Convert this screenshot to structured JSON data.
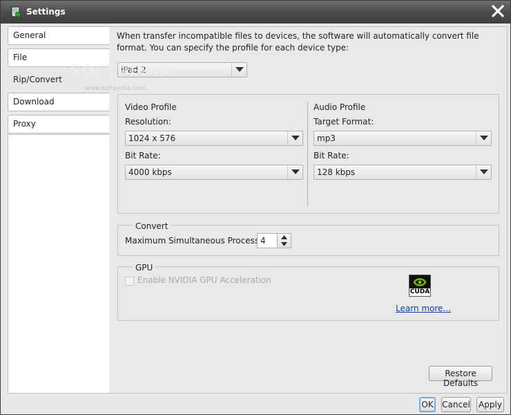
{
  "window": {
    "title": "Settings"
  },
  "sidebar": {
    "items": [
      {
        "label": "General"
      },
      {
        "label": "File"
      },
      {
        "label": "Rip/Convert"
      },
      {
        "label": "Download"
      },
      {
        "label": "Proxy"
      }
    ],
    "active": "Rip/Convert"
  },
  "content": {
    "description": "When transfer incompatible files to devices, the software will automatically convert file format. You can specify the profile for each device type:",
    "device_select": {
      "value": "iPad 2"
    },
    "video_profile": {
      "title": "Video Profile",
      "resolution_label": "Resolution:",
      "resolution_value": "1024 x 576",
      "bitrate_label": "Bit Rate:",
      "bitrate_value": "4000 kbps"
    },
    "audio_profile": {
      "title": "Audio Profile",
      "format_label": "Target Format:",
      "format_value": "mp3",
      "bitrate_label": "Bit Rate:",
      "bitrate_value": "128 kbps"
    },
    "convert": {
      "title": "Convert",
      "max_processes_label": "Maximum Simultaneous Processes:",
      "max_processes_value": "4"
    },
    "gpu": {
      "title": "GPU",
      "enable_label": "Enable NVIDIA GPU Acceleration",
      "enable_checked": false,
      "logo_text": "CUDA",
      "learn_more": "Learn more..."
    },
    "restore_defaults": "Restore Defaults"
  },
  "footer": {
    "ok": "OK",
    "cancel": "Cancel",
    "apply": "Apply"
  },
  "watermark": {
    "text": "SOFTPEDIA",
    "sub": "www.softpedia.com"
  },
  "icons": [
    "app-icon",
    "close-icon",
    "chevron-down-icon",
    "spinner-up-icon",
    "spinner-down-icon",
    "cuda-logo-icon"
  ]
}
